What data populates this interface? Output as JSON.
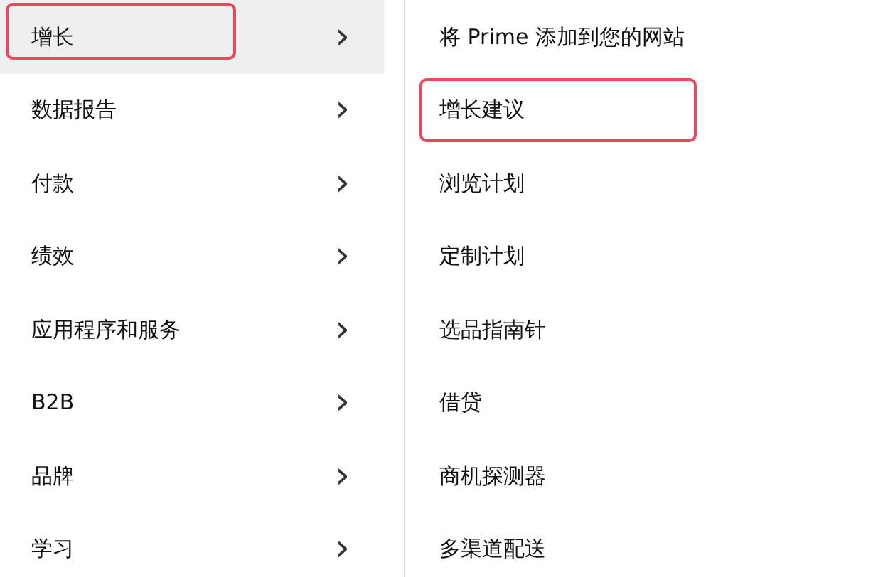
{
  "categories": [
    {
      "label": "增长",
      "selected": true,
      "annotated": true
    },
    {
      "label": "数据报告",
      "selected": false,
      "annotated": false
    },
    {
      "label": "付款",
      "selected": false,
      "annotated": false
    },
    {
      "label": "绩效",
      "selected": false,
      "annotated": false
    },
    {
      "label": "应用程序和服务",
      "selected": false,
      "annotated": false
    },
    {
      "label": "B2B",
      "selected": false,
      "annotated": false
    },
    {
      "label": "品牌",
      "selected": false,
      "annotated": false
    },
    {
      "label": "学习",
      "selected": false,
      "annotated": false
    }
  ],
  "chevron": "›",
  "submenu": [
    {
      "label": "将 Prime 添加到您的网站",
      "annotated": false
    },
    {
      "label": "增长建议",
      "annotated": true
    },
    {
      "label": "浏览计划",
      "annotated": false
    },
    {
      "label": "定制计划",
      "annotated": false
    },
    {
      "label": "选品指南针",
      "annotated": false
    },
    {
      "label": "借贷",
      "annotated": false
    },
    {
      "label": "商机探测器",
      "annotated": false
    },
    {
      "label": "多渠道配送",
      "annotated": false
    }
  ]
}
